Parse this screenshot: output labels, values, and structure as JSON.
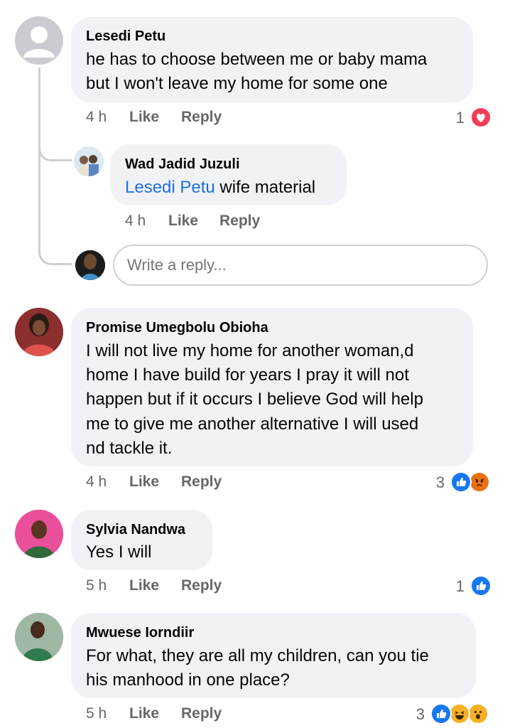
{
  "comments": [
    {
      "author": "Lesedi Petu",
      "text_lines": [
        "he has to choose between me or baby mama",
        "but I won't leave my home for some one"
      ],
      "time": "4 h",
      "like": "Like",
      "reply": "Reply",
      "reaction_count": "1",
      "reactions": [
        "love-icon"
      ]
    },
    {
      "author": "Wad Jadid Juzuli",
      "mention": "Lesedi Petu",
      "text": " wife material",
      "time": "4 h",
      "like": "Like",
      "reply": "Reply"
    },
    {
      "author": "Promise Umegbolu Obioha",
      "text_lines": [
        "I will not live my home for another woman,d",
        "home I have build for years I pray it will not",
        "happen but if it occurs I believe God will help",
        "me to give me another alternative I will used",
        "nd tackle it."
      ],
      "time": "4 h",
      "like": "Like",
      "reply": "Reply",
      "reaction_count": "3",
      "reactions": [
        "like-icon",
        "angry-icon"
      ]
    },
    {
      "author": "Sylvia Nandwa",
      "text_lines": [
        "Yes I will"
      ],
      "time": "5 h",
      "like": "Like",
      "reply": "Reply",
      "reaction_count": "1",
      "reactions": [
        "like-icon"
      ]
    },
    {
      "author": "Mwuese Iorndiir",
      "text_lines": [
        "For what, they are all my children, can you tie",
        "his manhood in one place?"
      ],
      "time": "5 h",
      "like": "Like",
      "reply": "Reply",
      "reaction_count": "3",
      "reactions": [
        "like-icon",
        "haha-icon",
        "wow-icon"
      ]
    }
  ],
  "reply_box": {
    "placeholder": "Write a reply..."
  },
  "colors": {
    "bubble": "#f0f2f5",
    "meta": "#65676b",
    "link": "#216fdb",
    "like": "#1877f2",
    "love": "#f33e58",
    "angry": "#e9710f",
    "haha": "#f7b125"
  }
}
